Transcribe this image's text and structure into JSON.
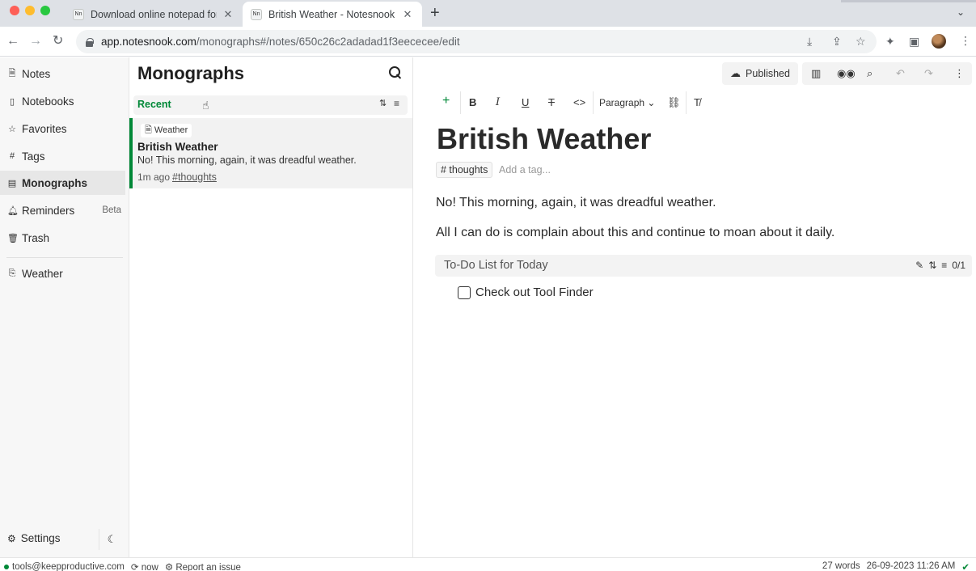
{
  "browser": {
    "tabs": [
      {
        "title": "Download online notepad for p",
        "favicon": "Nn",
        "active": false
      },
      {
        "title": "British Weather - Notesnook",
        "favicon": "Nn",
        "active": true
      }
    ],
    "url_host": "app.notesnook.com",
    "url_path": "/monographs#/notes/650c26c2adadad1f3eececee/edit",
    "icons": [
      "back-icon",
      "forward-icon",
      "reload-icon",
      "lock-icon",
      "download-icon",
      "share-icon",
      "star-icon",
      "extensions-icon",
      "sidepanel-icon",
      "avatar",
      "kebab-icon"
    ]
  },
  "nav": {
    "items": [
      {
        "label": "Notes",
        "icon": "note-icon"
      },
      {
        "label": "Notebooks",
        "icon": "notebook-icon"
      },
      {
        "label": "Favorites",
        "icon": "star-icon"
      },
      {
        "label": "Tags",
        "icon": "hash-icon"
      },
      {
        "label": "Monographs",
        "icon": "monograph-icon",
        "active": true
      },
      {
        "label": "Reminders",
        "icon": "bell-icon",
        "badge": "Beta"
      },
      {
        "label": "Trash",
        "icon": "trash-icon"
      },
      {
        "label": "Weather",
        "icon": "notebook-shortcut-icon"
      }
    ],
    "settings": "Settings"
  },
  "list": {
    "title": "Monographs",
    "group": "Recent",
    "notes": [
      {
        "notebook": "Weather",
        "title": "British Weather",
        "preview": "No! This morning, again, it was dreadful weather.",
        "time": "1m ago",
        "tag": "#thoughts"
      }
    ]
  },
  "editor": {
    "published_label": "Published",
    "paragraph_label": "Paragraph",
    "title": "British Weather",
    "tag": "# thoughts",
    "add_tag_placeholder": "Add a tag...",
    "paragraphs": [
      "No! This morning, again, it was dreadful weather.",
      "All I can do is complain about this and continue to moan about it daily."
    ],
    "todo": {
      "title": "To-Do List for Today",
      "progress": "0/1",
      "items": [
        {
          "text": "Check out Tool Finder",
          "checked": false
        }
      ]
    }
  },
  "status": {
    "email": "tools@keepproductive.com",
    "sync": "now",
    "report": "Report an issue",
    "words": "27 words",
    "datetime": "26-09-2023 11:26 AM"
  },
  "colors": {
    "accent": "#008837"
  }
}
